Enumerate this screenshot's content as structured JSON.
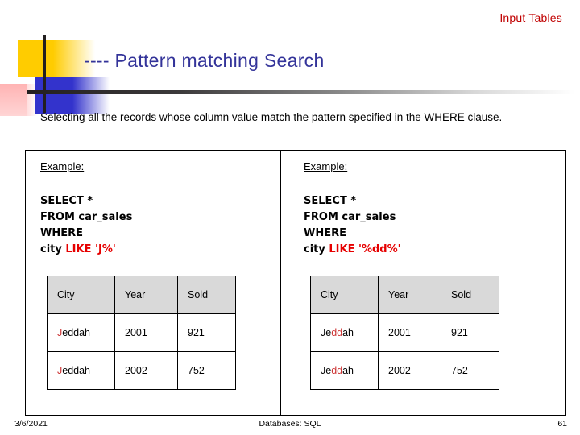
{
  "header": {
    "input_tables_label": "Input Tables",
    "accent_red": "#c00000"
  },
  "title": {
    "text": "---- Pattern matching Search",
    "color": "#333399"
  },
  "intro": {
    "text": "Selecting all the records whose column value match the pattern specified in the WHERE clause."
  },
  "panels": [
    {
      "example_label": "Example:",
      "code": {
        "line1": "SELECT *",
        "line2": "FROM car_sales",
        "line3": "WHERE",
        "line4_col": "city",
        "line4_kw": "LIKE",
        "line4_pattern": "'J%'"
      },
      "table": {
        "columns": [
          "City",
          "Year",
          "Sold"
        ],
        "rows": [
          {
            "city_match": "J",
            "city_rest": "eddah",
            "year": "2001",
            "sold": "921"
          },
          {
            "city_match": "J",
            "city_rest": "eddah",
            "year": "2002",
            "sold": "752"
          }
        ]
      }
    },
    {
      "example_label": "Example:",
      "code": {
        "line1": "SELECT *",
        "line2": "FROM car_sales",
        "line3": "WHERE",
        "line4_col": "city",
        "line4_kw": "LIKE",
        "line4_pattern": "'%dd%'"
      },
      "table": {
        "columns": [
          "City",
          "Year",
          "Sold"
        ],
        "rows": [
          {
            "city_pre": "Je",
            "city_match": "dd",
            "city_post": "ah",
            "year": "2001",
            "sold": "921"
          },
          {
            "city_pre": "Je",
            "city_match": "dd",
            "city_post": "ah",
            "year": "2002",
            "sold": "752"
          }
        ]
      }
    }
  ],
  "footer": {
    "date": "3/6/2021",
    "center": "Databases: SQL",
    "page_number": "61"
  }
}
